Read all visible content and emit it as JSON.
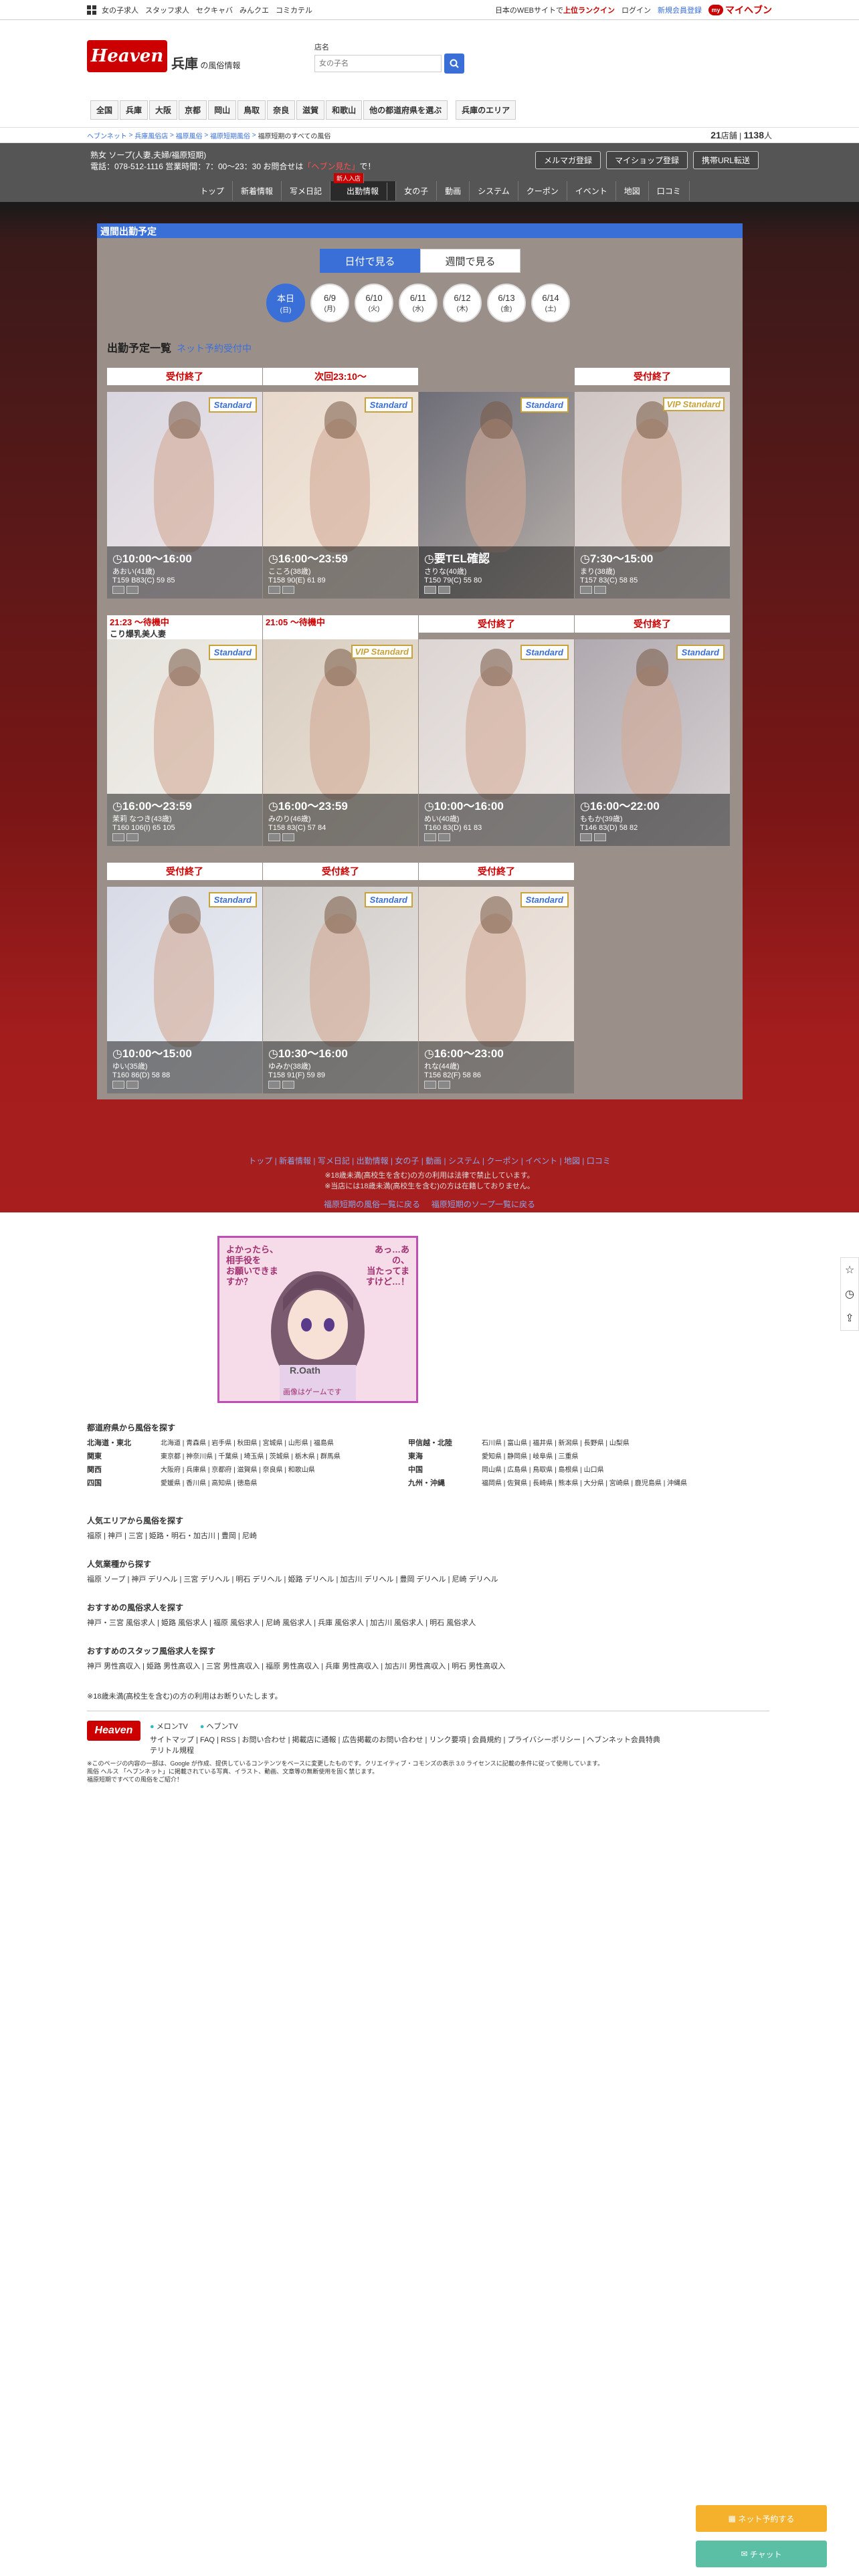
{
  "topbar": {
    "links": [
      "女の子求人",
      "スタッフ求人",
      "セクキャバ",
      "みんクエ",
      "コミカテル"
    ],
    "tagline_prefix": "日本のWEBサイトで",
    "tagline_rank": "上位ランクイン",
    "login": "ログイン",
    "register": "新規会員登録",
    "my_badge": "my",
    "my_heaven": "マイヘブン"
  },
  "header": {
    "logo_text": "Heaven",
    "logo_sub": "シティヘブンネット",
    "region": "兵庫",
    "region_sub": "の風俗情報",
    "search_label": "店名",
    "search_placeholder": "女の子名",
    "prefectures": [
      "全国",
      "兵庫",
      "大阪",
      "京都",
      "岡山",
      "鳥取",
      "奈良",
      "滋賀",
      "和歌山",
      "他の都道府県を選ぶ",
      "兵庫のエリア"
    ]
  },
  "breadcrumb": {
    "items": [
      "ヘブンネット",
      "兵庫風俗店",
      "福原風俗",
      "福原短期風俗",
      "福原短期のすべての風俗"
    ],
    "shop_count": "21",
    "shop_unit": "店舗",
    "girl_count": "1138",
    "girl_unit": "人"
  },
  "shop": {
    "name": "熟女 ソープ(人妻,夫婦/福原短期)",
    "phone_text": "電話：078-512-1116 営業時間：7：00〜23：30 お問合せは",
    "phone_highlight": "「ヘブン見た」",
    "phone_suffix": "で！",
    "buttons": [
      "メルマガ登録",
      "マイショップ登録",
      "携帯URL転送"
    ],
    "tabs": [
      "トップ",
      "新着情報",
      "写メ日記",
      "出勤情報",
      "女の子",
      "動画",
      "システム",
      "クーポン",
      "イベント",
      "地図",
      "口コミ"
    ],
    "new_badge": "新人入店"
  },
  "schedule": {
    "title": "週間出勤予定",
    "view_day": "日付で見る",
    "view_week": "週間で見る",
    "days": [
      {
        "d": "本日",
        "w": "(日)"
      },
      {
        "d": "6/9",
        "w": "(月)"
      },
      {
        "d": "6/10",
        "w": "(火)"
      },
      {
        "d": "6/11",
        "w": "(水)"
      },
      {
        "d": "6/12",
        "w": "(木)"
      },
      {
        "d": "6/13",
        "w": "(金)"
      },
      {
        "d": "6/14",
        "w": "(土)"
      }
    ],
    "section_title": "出勤予定一覧",
    "section_link": "ネット予約受付中"
  },
  "cards": [
    {
      "status": "受付終了",
      "time": "10:00〜16:00",
      "name": "あおい(41歳)",
      "spec": "T159 B83(C) 59 85",
      "tag": "Standard"
    },
    {
      "status": "次回23:10〜",
      "time": "16:00〜23:59",
      "name": "こころ(38歳)",
      "spec": "T158 90(E) 61 89",
      "tag": "Standard"
    },
    {
      "status": "",
      "time": "要TEL確認",
      "name": "さりな(40歳)",
      "spec": "T150 79(C) 55 80",
      "tag": "Standard"
    },
    {
      "status": "受付終了",
      "time": "7:30〜15:00",
      "name": "まり(38歳)",
      "spec": "T157 83(C) 58 85",
      "tag": "VIP Standard"
    },
    {
      "status": "21:23 〜待機中",
      "sub": "こり爆乳美人妻",
      "time": "16:00〜23:59",
      "name": "茉莉 なつき(43歳)",
      "spec": "T160 106(I) 65 105",
      "tag": "Standard"
    },
    {
      "status": "21:05 〜待機中",
      "time": "16:00〜23:59",
      "name": "みのり(46歳)",
      "spec": "T158 83(C) 57 84",
      "tag": "VIP Standard"
    },
    {
      "status": "受付終了",
      "time": "10:00〜16:00",
      "name": "めい(40歳)",
      "spec": "T160 83(D) 61 83",
      "tag": "Standard"
    },
    {
      "status": "受付終了",
      "time": "16:00〜22:00",
      "name": "ももか(39歳)",
      "spec": "T146 83(D) 58 82",
      "tag": "Standard"
    },
    {
      "status": "受付終了",
      "time": "10:00〜15:00",
      "name": "ゆい(35歳)",
      "spec": "T160 86(D) 58 88",
      "tag": "Standard"
    },
    {
      "status": "受付終了",
      "time": "10:30〜16:00",
      "name": "ゆみか(38歳)",
      "spec": "T158 91(F) 59 89",
      "tag": "Standard"
    },
    {
      "status": "受付終了",
      "time": "16:00〜23:00",
      "name": "れな(44歳)",
      "spec": "T156 82(F) 58 86",
      "tag": "Standard"
    }
  ],
  "footer_nav": {
    "links": "トップ | 新着情報 | 写メ日記 | 出勤情報 | 女の子 | 動画 | システム | クーポン | イベント | 地図 | 口コミ",
    "note1": "※18歳未満(高校生を含む)の方の利用は法律で禁止しています。",
    "note2": "※当店には18歳未満(高校生を含む)の方は在籍しておりません。",
    "back1": "福原短期の風俗一覧に戻る",
    "back2": "福原短期のソープ一覧に戻る"
  },
  "banner": {
    "line1": "よかったら、相手役を",
    "line2": "お願いできますか？",
    "line3": "あっ…あの、",
    "line4": "当たってますけど…！",
    "brand": "R.Oath",
    "bottom": "画像はゲームです"
  },
  "pref_section": {
    "title": "都道府県から風俗を探す",
    "rows": [
      [
        "北海道・東北",
        "北海道 | 青森県 | 岩手県 | 秋田県 | 宮城県 | 山形県 | 福島県",
        "甲信越・北陸",
        "石川県 | 富山県 | 福井県 | 新潟県 | 長野県 | 山梨県"
      ],
      [
        "関東",
        "東京都 | 神奈川県 | 千葉県 | 埼玉県 | 茨城県 | 栃木県 | 群馬県",
        "東海",
        "愛知県 | 静岡県 | 岐阜県 | 三重県"
      ],
      [
        "関西",
        "大阪府 | 兵庫県 | 京都府 | 滋賀県 | 奈良県 | 和歌山県",
        "中国",
        "岡山県 | 広島県 | 鳥取県 | 島根県 | 山口県"
      ],
      [
        "四国",
        "愛媛県 | 香川県 | 高知県 | 徳島県",
        "九州・沖縄",
        "福岡県 | 佐賀県 | 長崎県 | 熊本県 | 大分県 | 宮崎県 | 鹿児島県 | 沖縄県"
      ]
    ]
  },
  "popular_area": {
    "title": "人気エリアから風俗を探す",
    "items": "福原 | 神戸 | 三宮 | 姫路・明石・加古川 | 豊岡 | 尼崎"
  },
  "popular_type": {
    "title": "人気業種から探す",
    "items": "福原 ソープ | 神戸 デリヘル | 三宮 デリヘル | 明石 デリヘル | 姫路 デリヘル | 加古川 デリヘル | 豊岡 デリヘル | 尼崎 デリヘル"
  },
  "recruit": {
    "title": "おすすめの風俗求人を探す",
    "items": "神戸・三宮 風俗求人 | 姫路 風俗求人 | 福原 風俗求人 | 尼崎 風俗求人 | 兵庫 風俗求人 | 加古川 風俗求人 | 明石 風俗求人"
  },
  "staff_recruit": {
    "title": "おすすめのスタッフ風俗求人を探す",
    "items": "神戸 男性高収入 | 姫路 男性高収入 | 三宮 男性高収入 | 福原 男性高収入 | 兵庫 男性高収入 | 加古川 男性高収入 | 明石 男性高収入"
  },
  "age_note": "※18歳未満(高校生を含む)の方の利用はお断りいたします。",
  "site_footer": {
    "logo": "Heaven",
    "partner1": "メロンTV",
    "partner2": "ヘブンTV",
    "links": "サイトマップ | FAQ | RSS | お問い合わせ | 掲載店に通報 | 広告掲載のお問い合わせ | リンク要項 | 会員規約 | プライバシーポリシー | ヘブンネット会員特典",
    "links_pre": "テリトル規程",
    "notice1": "※このページの内容の一部は、Google が作成、提供しているコンテンツをベースに変更したものです。クリエイティブ・コモンズの表示 3.0 ライセンスに記載の条件に従って使用しています。",
    "notice2": "風俗 ヘルス 「ヘブンネット」に掲載されている写真、イラスト、動画、文章等の無断使用を固く禁じます。",
    "notice3": "福原短期ですべての風俗をご紹介！"
  },
  "float": {
    "reserve": "ネット予約する",
    "chat": "チャット"
  },
  "colors": {
    "brand_red": "#cc0000",
    "accent_blue": "#3b6fd8",
    "gold": "#c8a23a"
  }
}
